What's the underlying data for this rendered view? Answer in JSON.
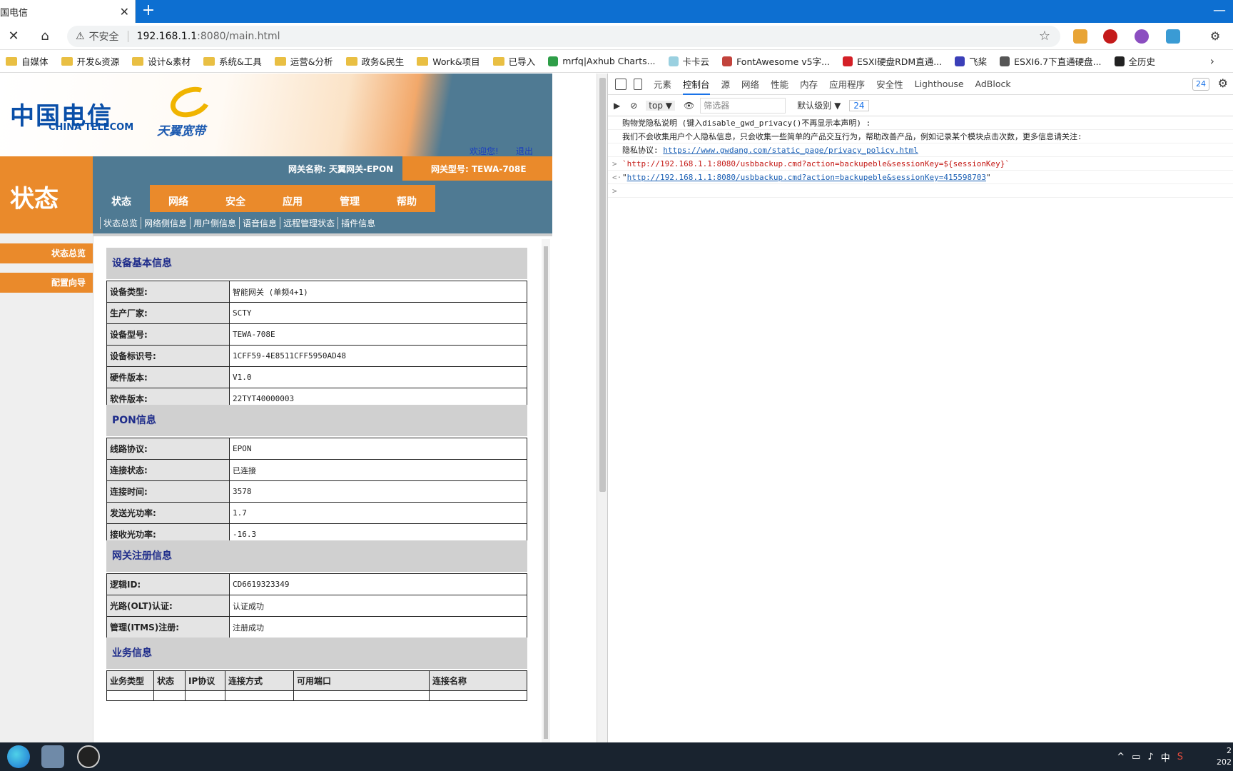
{
  "browser": {
    "tab_title": "国电信",
    "tab_close": "✕",
    "new_tab": "+",
    "window_min": "—",
    "back_icon": "✕",
    "home_icon": "⌂",
    "warn_icon": "⚠",
    "insecure": "不安全",
    "url_host": "192.168.1.1",
    "url_path": ":8080/main.html"
  },
  "bookmarks": [
    {
      "label": "自媒体",
      "type": "folder"
    },
    {
      "label": "开发&资源",
      "type": "folder"
    },
    {
      "label": "设计&素材",
      "type": "folder"
    },
    {
      "label": "系统&工具",
      "type": "folder"
    },
    {
      "label": "运营&分析",
      "type": "folder"
    },
    {
      "label": "政务&民生",
      "type": "folder"
    },
    {
      "label": "Work&项目",
      "type": "folder"
    },
    {
      "label": "已导入",
      "type": "folder"
    },
    {
      "label": "mrfq|Axhub Charts...",
      "type": "site",
      "color": "#2e9e48"
    },
    {
      "label": "卡卡云",
      "type": "site",
      "color": "#9ad0e0"
    },
    {
      "label": "FontAwesome v5字...",
      "type": "site",
      "color": "#c2433c"
    },
    {
      "label": "ESXI硬盘RDM直通...",
      "type": "site",
      "color": "#d42027"
    },
    {
      "label": "飞桨",
      "type": "site",
      "color": "#3b3fb8"
    },
    {
      "label": "ESXI6.7下直通硬盘...",
      "type": "site",
      "color": "#555555"
    },
    {
      "label": "全历史",
      "type": "site",
      "color": "#222222"
    }
  ],
  "router": {
    "logo_cn": "中国电信",
    "logo_en": "CHINA TELECOM",
    "logo_ty": "天翼宽带",
    "welcome": "欢迎您!",
    "logout": "退出",
    "page_heading": "状态",
    "gateway_name": "网关名称: 天翼网关-EPON",
    "gateway_model": "网关型号: TEWA-708E",
    "nav": [
      "状态",
      "网络",
      "安全",
      "应用",
      "管理",
      "帮助"
    ],
    "subnav": [
      "状态总览",
      "网络侧信息",
      "用户侧信息",
      "语音信息",
      "远程管理状态",
      "插件信息"
    ],
    "side": [
      "状态总览",
      "配置向导"
    ],
    "sections": {
      "device": {
        "title": "设备基本信息",
        "rows": [
          {
            "k": "设备类型:",
            "v": "智能网关 (单频4+1)"
          },
          {
            "k": "生产厂家:",
            "v": "SCTY"
          },
          {
            "k": "设备型号:",
            "v": "TEWA-708E"
          },
          {
            "k": "设备标识号:",
            "v": "1CFF59-4E8511CFF5950AD48"
          },
          {
            "k": "硬件版本:",
            "v": "V1.0"
          },
          {
            "k": "软件版本:",
            "v": "22TYT40000003"
          }
        ]
      },
      "pon": {
        "title": "PON信息",
        "rows": [
          {
            "k": "线路协议:",
            "v": "EPON"
          },
          {
            "k": "连接状态:",
            "v": "已连接"
          },
          {
            "k": "连接时间:",
            "v": "3578"
          },
          {
            "k": "发送光功率:",
            "v": "1.7"
          },
          {
            "k": "接收光功率:",
            "v": "-16.3"
          }
        ]
      },
      "reg": {
        "title": "网关注册信息",
        "rows": [
          {
            "k": "逻辑ID:",
            "v": "CD6619323349"
          },
          {
            "k": "光路(OLT)认证:",
            "v": "认证成功"
          },
          {
            "k": "管理(ITMS)注册:",
            "v": "注册成功"
          }
        ]
      },
      "biz": {
        "title": "业务信息",
        "headers": [
          "业务类型",
          "状态",
          "IP协议",
          "连接方式",
          "可用端口",
          "连接名称"
        ]
      }
    }
  },
  "devtools": {
    "tabs": [
      "元素",
      "控制台",
      "源",
      "网络",
      "性能",
      "内存",
      "应用程序",
      "安全性",
      "Lighthouse",
      "AdBlock"
    ],
    "active_tab": "控制台",
    "badge": "24",
    "context": "top ▼",
    "filter_placeholder": "筛选器",
    "level": "默认级别 ▼",
    "issues": "24",
    "console_lines": [
      {
        "pre": "",
        "text": "购物党隐私说明 (键入disable_gwd_privacy()不再显示本声明) :"
      },
      {
        "pre": "",
        "text": "    我们不会收集用户个人隐私信息，只会收集一些简单的产品交互行为，帮助改善产品，例如记录某个模块点击次数，更多信息请关注:"
      },
      {
        "pre": "",
        "text": "隐私协议: ",
        "link": "https://www.gwdang.com/static_page/privacy_policy.html"
      },
      {
        "pre": ">",
        "str": "`http://192.168.1.1:8080/usbbackup.cmd?action=backupeble&sessionKey=${sessionKey}`"
      },
      {
        "pre": "<·",
        "text": "\"",
        "link": "http://192.168.1.1:8080/usbbackup.cmd?action=backupeble&sessionKey=415598703",
        "tail": "\""
      },
      {
        "pre": ">",
        "text": ""
      }
    ]
  },
  "taskbar": {
    "tray": [
      "^",
      "中",
      "S"
    ],
    "clock_time": "2",
    "clock_date": "202"
  }
}
